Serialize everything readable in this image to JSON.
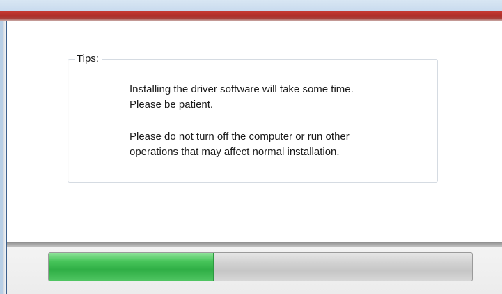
{
  "tips": {
    "legend": "Tips:",
    "line1": "Installing the driver software will take some time.",
    "line2": "Please be patient.",
    "line3": "Please do not turn off the computer or run other",
    "line4": "operations that may affect normal installation."
  },
  "progress": {
    "fraction": 0.39,
    "fill_color": "#3dbb51",
    "track_color": "#cccccc"
  },
  "colors": {
    "accent_band": "#b02f29",
    "title_strip": "#c9dbee"
  }
}
